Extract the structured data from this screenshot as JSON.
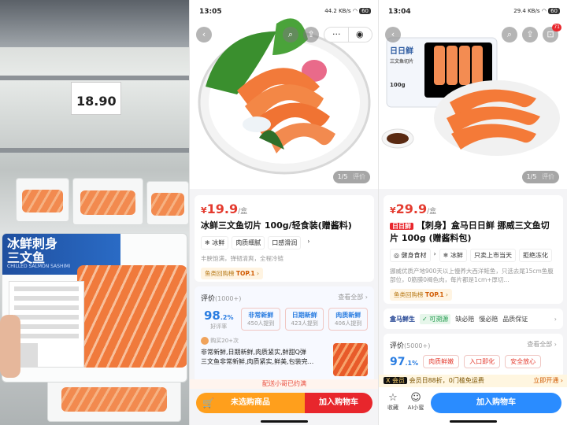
{
  "left_photo": {
    "shelf_price": "18.90",
    "package_title": "冰鲜刺身\n三文鱼",
    "package_subtitle": "CHILLED SALMON SASHIMI"
  },
  "middle": {
    "status_time": "13:05",
    "status_right": "44.2 KB/s",
    "battery": "60",
    "pager": "1/5",
    "pager_review": "评价",
    "price": {
      "yen": "¥",
      "value": "19.9",
      "unit": "/盒"
    },
    "title": "冰鲜三文鱼切片 100g/轻食装(赠酱料)",
    "chips": [
      "❄ 冰鲜",
      "肉质细腻",
      "口感滑润",
      "›"
    ],
    "desc": "丰腴饱满，弹韧清爽，全程冷链",
    "rank": {
      "prefix": "鱼类回购榜",
      "label": "TOP.1",
      "suffix": "›"
    },
    "review": {
      "title": "评价",
      "count": "(1000+)",
      "see_all": "查看全部 ›",
      "rate": "98",
      "rate_suffix": ".2%",
      "rate_label": "好评率",
      "tags": [
        {
          "t": "非常新鲜",
          "c": "450人提到"
        },
        {
          "t": "日期新鲜",
          "c": "423人提到"
        },
        {
          "t": "肉质新鲜",
          "c": "406人提到"
        }
      ],
      "user": "购买20+次",
      "text_line1": "非常新鲜,日期新鲜,肉质紧实,鲜甜Q弹",
      "text_line2": "三文鱼非常新鲜,肉质紧实,鲜美,包装完..."
    },
    "delivery_note": "配送小哥已约满",
    "buttons": {
      "unselected": "未选购商品",
      "add_cart": "加入购物车"
    }
  },
  "right": {
    "status_time": "13:04",
    "status_right": "29.4 KB/s",
    "battery": "60",
    "cart_badge": "71",
    "pager": "1/5",
    "pager_review": "评价",
    "price": {
      "yen": "¥",
      "value": "29.9",
      "unit": "/盒"
    },
    "brand_tag": "日日鲜",
    "title": "【刺身】盒马日日鲜 挪威三文鱼切片 100g (赠酱料包)",
    "chips": [
      "◎ 健身食材",
      "›",
      "❄ 冰鲜",
      "只卖上市当天",
      "拒绝冻化"
    ],
    "desc": "挪威优质产地900天以上慢养大西洋鲑鱼，只选去尾15cm鱼腹部位，0筋膜0褐色肉，每片都是1cm+厚切...",
    "rank": {
      "prefix": "鱼类回购榜",
      "label": "TOP.1",
      "suffix": "›"
    },
    "service": {
      "brand": "盒马鲜生",
      "trace": "✓ 可溯源",
      "items": [
        "缺必赔",
        "慢必赔",
        "品质保证"
      ]
    },
    "review": {
      "title": "评价",
      "count": "(5000+)",
      "see_all": "查看全部 ›",
      "rate": "97",
      "rate_suffix": ".1%",
      "tags": [
        "肉质鲜嫩",
        "入口即化",
        "安全放心"
      ]
    },
    "member": {
      "badge": "X 会员",
      "text": "会员日88折，0门槛免运费",
      "cta": "立即开通 ›"
    },
    "nav": {
      "fav": "收藏",
      "ai": "AI小蜜"
    },
    "add_cart": "加入购物车",
    "box_label": "日日鲜",
    "box_sub": "三文鱼切片",
    "box_weight": "100g"
  }
}
